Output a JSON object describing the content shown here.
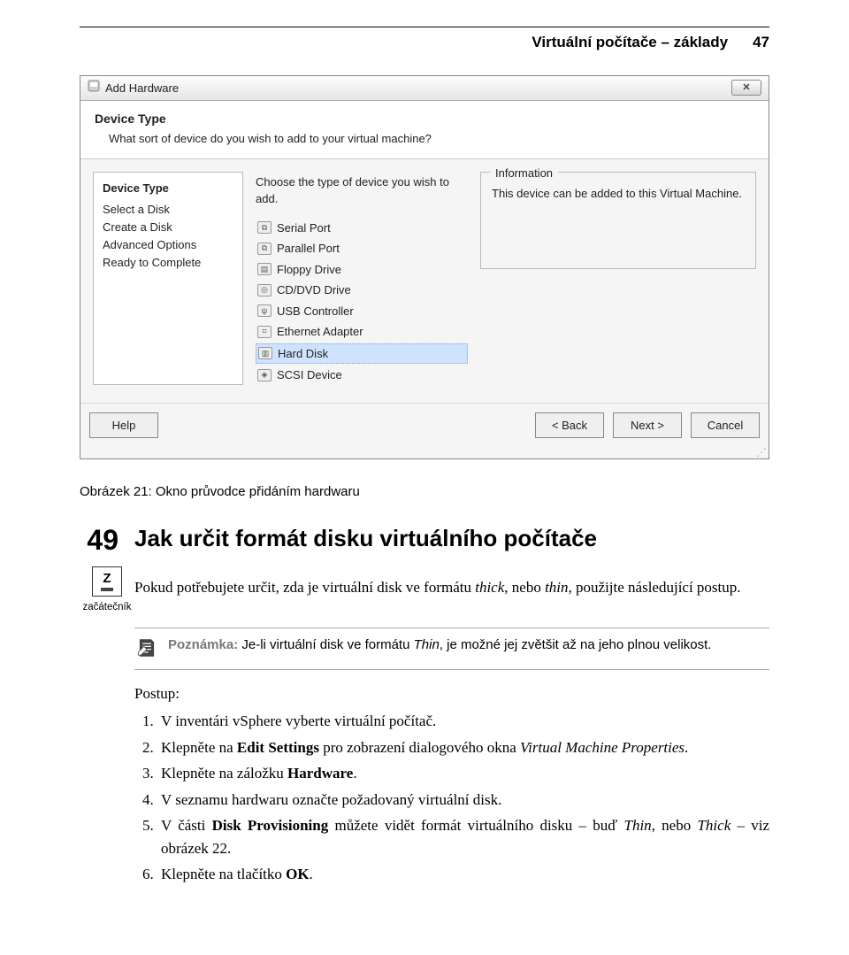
{
  "header": {
    "title": "Virtuální počítače – základy",
    "page_number": "47"
  },
  "dialog": {
    "title": "Add Hardware",
    "section_title": "Device Type",
    "section_sub": "What sort of device do you wish to add to your virtual machine?",
    "side_header": "Device Type",
    "side_items": [
      "Select a Disk",
      "Create a Disk",
      "Advanced Options",
      "Ready to Complete"
    ],
    "mid_hint": "Choose the type of device you wish to add.",
    "devices": [
      "Serial Port",
      "Parallel Port",
      "Floppy Drive",
      "CD/DVD Drive",
      "USB Controller",
      "Ethernet Adapter",
      "Hard Disk",
      "SCSI Device"
    ],
    "selected_index": 6,
    "info_legend": "Information",
    "info_text": "This device can be added to this Virtual Machine.",
    "help": "Help",
    "back": "< Back",
    "next": "Next >",
    "cancel": "Cancel"
  },
  "caption": "Obrázek 21: Okno průvodce přidáním hardwaru",
  "tip": {
    "number": "49",
    "heading": "Jak určit formát disku virtuálního počítače",
    "badge_letter": "Z",
    "badge_label": "začátečník"
  },
  "intro": {
    "t1": "Pokud potřebujete určit, zda je virtuální disk ve formátu ",
    "i1": "thick",
    "t2": ", nebo ",
    "i2": "thin",
    "t3": ", použijte následující postup."
  },
  "note": {
    "label": "Poznámka:",
    "t1": " Je-li virtuální disk ve formátu ",
    "i1": "Thin",
    "t2": ", je možné jej zvětšit až na jeho plnou velikost."
  },
  "postup_label": "Postup:",
  "steps": {
    "s1": "V inventári vSphere vyberte virtuální počítač.",
    "s2a": "Klepněte na ",
    "s2b": "Edit Settings",
    "s2c": " pro zobrazení dialogového okna ",
    "s2d": "Virtual Machine Properties",
    "s2e": ".",
    "s3a": "Klepněte na záložku ",
    "s3b": "Hardware",
    "s3c": ".",
    "s4": "V seznamu hardwaru označte požadovaný virtuální disk.",
    "s5a": "V části ",
    "s5b": "Disk Provisioning",
    "s5c": " můžete vidět formát virtuálního disku – buď ",
    "s5d": "Thin",
    "s5e": ", nebo ",
    "s5f": "Thick",
    "s5g": " – viz obrázek 22.",
    "s6a": "Klepněte na tlačítko ",
    "s6b": "OK",
    "s6c": "."
  }
}
